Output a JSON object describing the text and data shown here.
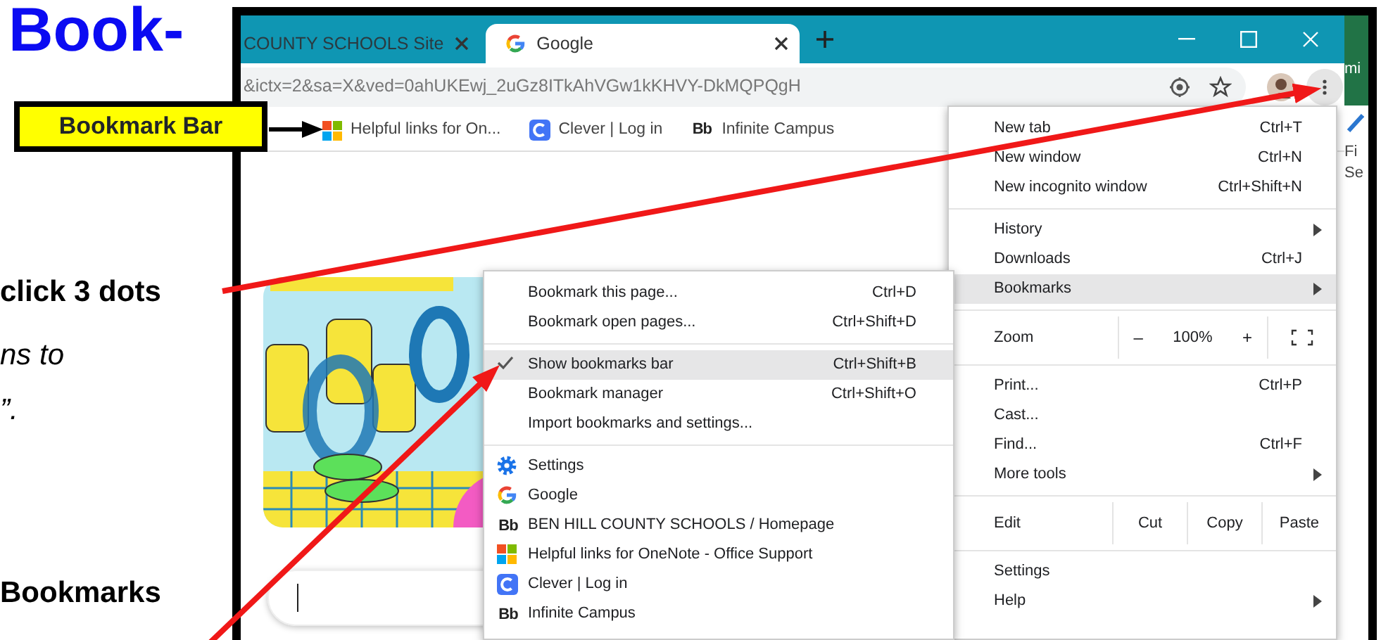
{
  "heading": "Book-",
  "instructions": [
    {
      "text": "click 3 dots",
      "kind": "step"
    },
    {
      "text": "ns to",
      "kind": "hint"
    },
    {
      "text": "”.",
      "kind": "hint"
    },
    {
      "text": "Bookmarks",
      "kind": "step"
    }
  ],
  "callout": {
    "label": "Bookmark Bar"
  },
  "browser": {
    "tabs": [
      {
        "title": "COUNTY SCHOOLS Site",
        "kind": "plain",
        "selected": false
      },
      {
        "title": "Google",
        "kind": "google",
        "selected": true
      }
    ],
    "address": "&ictx=2&sa=X&ved=0ahUKEwj_2uGz8ITkAhVGw1kKHVY-DkMQPQgH",
    "bookmarks_bar": [
      {
        "label": "Helpful links for On...",
        "kind": "microsoft"
      },
      {
        "label": "Clever | Log in",
        "kind": "clever"
      },
      {
        "label": "Infinite Campus",
        "kind": "lettered",
        "letters": "Bb"
      }
    ]
  },
  "bookmarks_menu": {
    "items": [
      {
        "kind": "item",
        "label": "Bookmark this page...",
        "shortcut": "Ctrl+D",
        "checked": false,
        "selected": false
      },
      {
        "kind": "item",
        "label": "Bookmark open pages...",
        "shortcut": "Ctrl+Shift+D",
        "checked": false,
        "selected": false
      },
      {
        "kind": "separator"
      },
      {
        "kind": "item",
        "label": "Show bookmarks bar",
        "shortcut": "Ctrl+Shift+B",
        "checked": true,
        "selected": true
      },
      {
        "kind": "item",
        "label": "Bookmark manager",
        "shortcut": "Ctrl+Shift+O",
        "checked": false,
        "selected": false
      },
      {
        "kind": "item",
        "label": "Import bookmarks and settings...",
        "checked": false,
        "selected": false
      },
      {
        "kind": "separator"
      },
      {
        "kind": "settings",
        "label": "Settings",
        "selected": false
      },
      {
        "kind": "google",
        "label": "Google",
        "selected": false
      },
      {
        "kind": "lettered",
        "label": "BEN HILL COUNTY SCHOOLS / Homepage",
        "letters": "Bb",
        "selected": false
      },
      {
        "kind": "microsoft",
        "label": "Helpful links for OneNote - Office Support",
        "selected": false
      },
      {
        "kind": "clever",
        "label": "Clever | Log in",
        "selected": false
      },
      {
        "kind": "lettered",
        "label": "Infinite Campus",
        "letters": "Bb",
        "selected": false
      }
    ]
  },
  "menu": {
    "items": [
      {
        "kind": "item",
        "label": "New tab",
        "shortcut": "Ctrl+T",
        "submenu": false,
        "selected": false
      },
      {
        "kind": "item",
        "label": "New window",
        "shortcut": "Ctrl+N",
        "submenu": false,
        "selected": false
      },
      {
        "kind": "item",
        "label": "New incognito window",
        "shortcut": "Ctrl+Shift+N",
        "submenu": false,
        "selected": false
      },
      {
        "kind": "separator"
      },
      {
        "kind": "item",
        "label": "History",
        "submenu": true,
        "selected": false
      },
      {
        "kind": "item",
        "label": "Downloads",
        "shortcut": "Ctrl+J",
        "submenu": false,
        "selected": false
      },
      {
        "kind": "item",
        "label": "Bookmarks",
        "submenu": true,
        "selected": true
      },
      {
        "kind": "separator"
      },
      {
        "kind": "zoom",
        "label": "Zoom",
        "minus": "–",
        "value": "100%",
        "plus": "+"
      },
      {
        "kind": "separator"
      },
      {
        "kind": "item",
        "label": "Print...",
        "shortcut": "Ctrl+P",
        "submenu": false,
        "selected": false
      },
      {
        "kind": "item",
        "label": "Cast...",
        "submenu": false,
        "selected": false
      },
      {
        "kind": "item",
        "label": "Find...",
        "shortcut": "Ctrl+F",
        "submenu": false,
        "selected": false
      },
      {
        "kind": "item",
        "label": "More tools",
        "submenu": true,
        "selected": false
      },
      {
        "kind": "separator"
      },
      {
        "kind": "edit",
        "label": "Edit",
        "actions": [
          "Cut",
          "Copy",
          "Paste"
        ]
      },
      {
        "kind": "separator"
      },
      {
        "kind": "item",
        "label": "Settings",
        "submenu": false,
        "selected": false
      },
      {
        "kind": "item",
        "label": "Help",
        "submenu": true,
        "selected": false
      }
    ]
  },
  "background_window": {
    "texts": [
      {
        "text": "mi",
        "kind": "ribbon"
      },
      {
        "text": "Fi",
        "kind": "label"
      },
      {
        "text": "Se",
        "kind": "label"
      }
    ]
  }
}
